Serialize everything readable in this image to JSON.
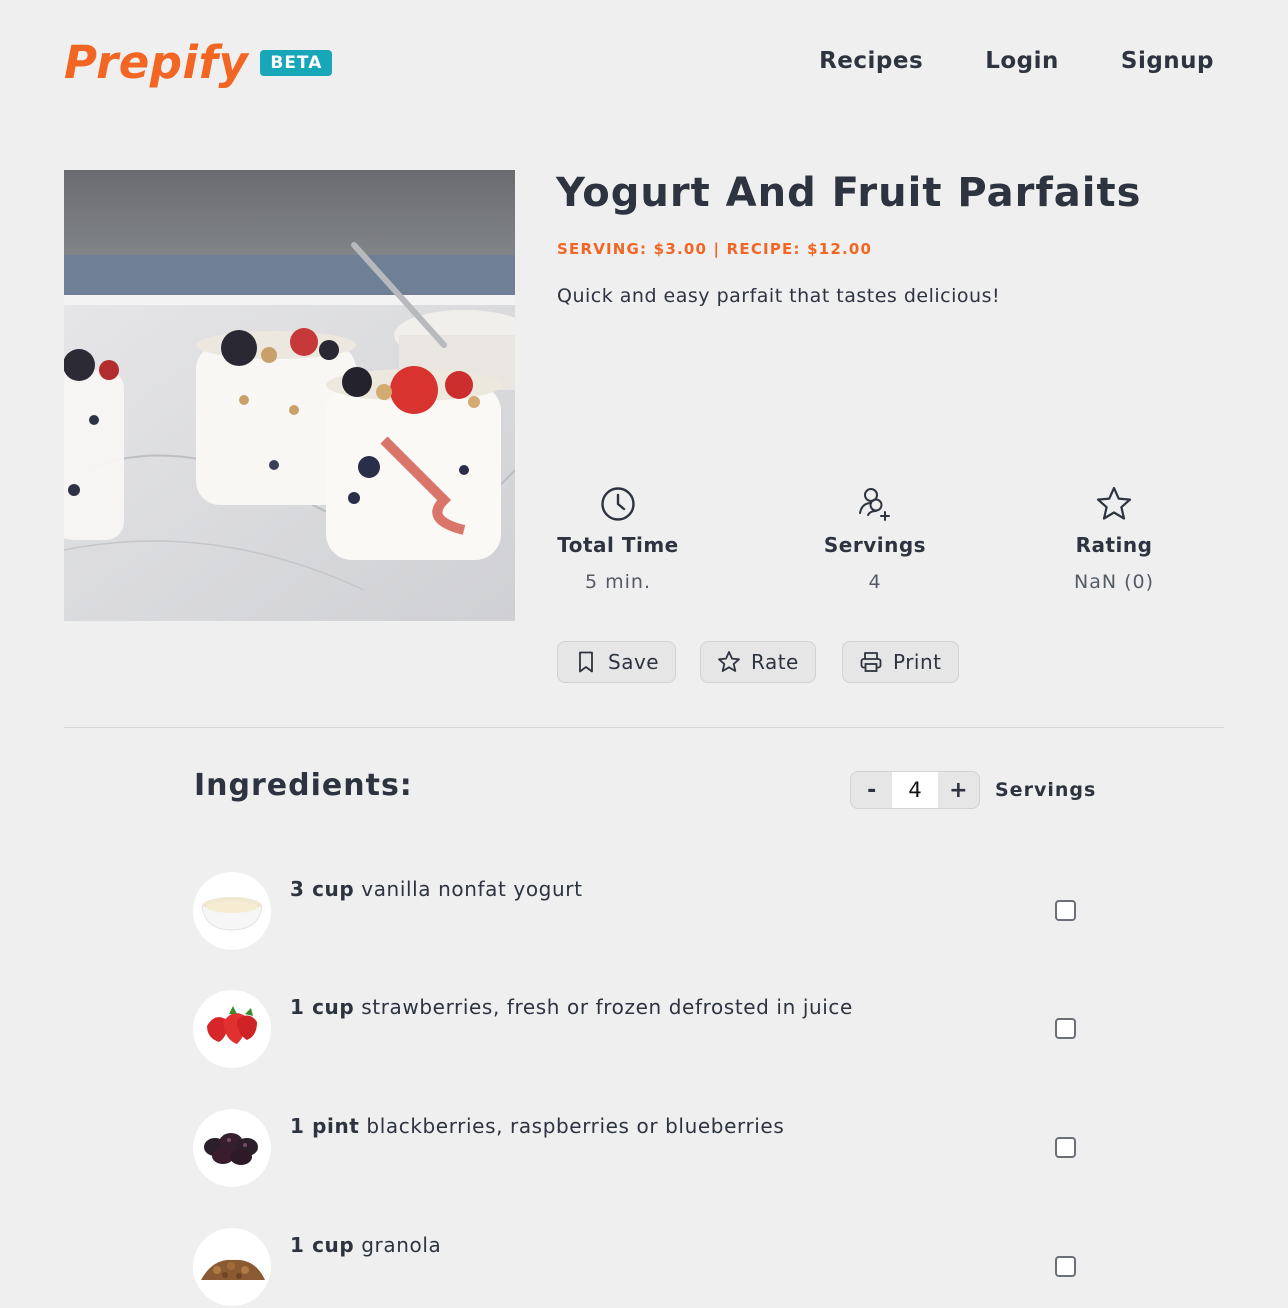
{
  "brand": {
    "name": "Prepify",
    "badge": "BETA",
    "color": "#f26522",
    "badge_color": "#17a7b8"
  },
  "nav": {
    "recipes": "Recipes",
    "login": "Login",
    "signup": "Signup"
  },
  "recipe": {
    "title": "Yogurt And Fruit Parfaits",
    "price_line": "SERVING: $3.00 | RECIPE: $12.00",
    "description": "Quick and easy parfait that tastes delicious!",
    "image": "parfait-photo"
  },
  "stats": {
    "time": {
      "label": "Total Time",
      "value": "5 min.",
      "icon": "clock-icon"
    },
    "servings": {
      "label": "Servings",
      "value": "4",
      "icon": "users-icon"
    },
    "rating": {
      "label": "Rating",
      "value": "NaN (0)",
      "icon": "star-icon"
    }
  },
  "actions": {
    "save": "Save",
    "rate": "Rate",
    "print": "Print"
  },
  "ingredients": {
    "title": "Ingredients:",
    "servings_value": "4",
    "servings_label": "Servings",
    "minus": "-",
    "plus": "+",
    "items": [
      {
        "qty": "3 cup",
        "name": "vanilla nonfat yogurt",
        "thumb": "yogurt-bowl",
        "checked": false
      },
      {
        "qty": "1 cup",
        "name": "strawberries, fresh or frozen defrosted in juice",
        "thumb": "strawberries",
        "checked": false
      },
      {
        "qty": "1 pint",
        "name": "blackberries, raspberries or blueberries",
        "thumb": "blackberries",
        "checked": false
      },
      {
        "qty": "1 cup",
        "name": "granola",
        "thumb": "granola",
        "checked": false
      }
    ]
  }
}
